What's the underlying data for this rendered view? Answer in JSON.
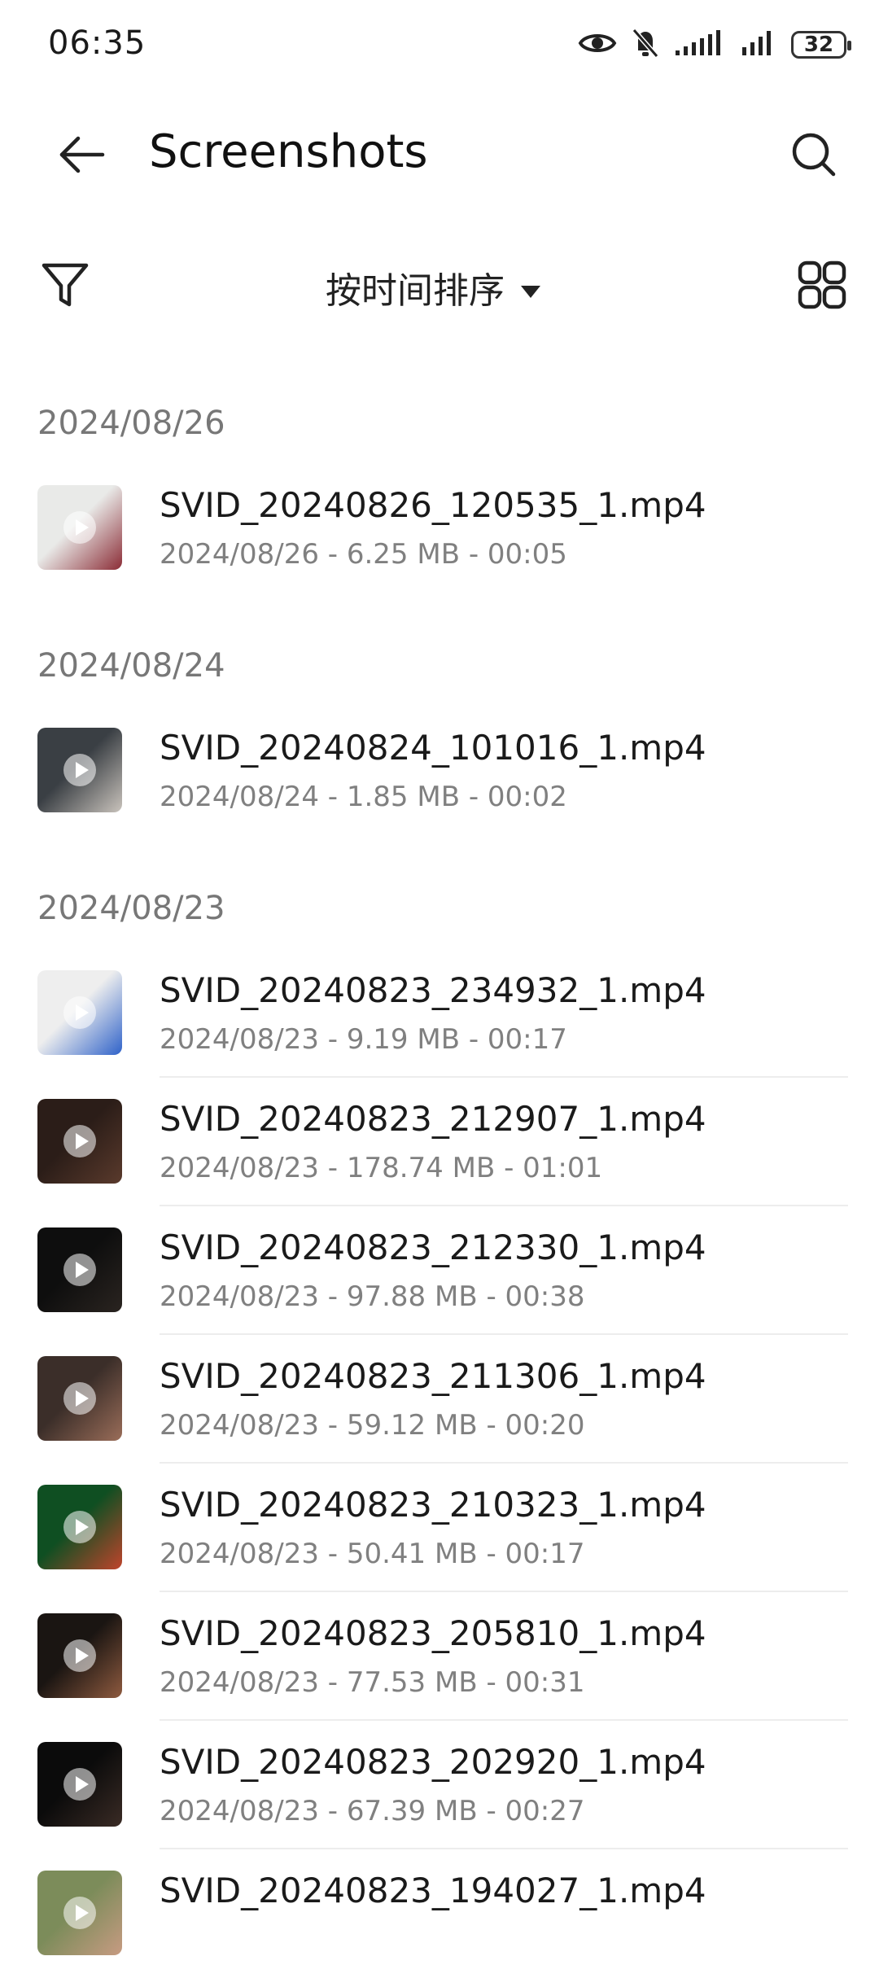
{
  "status_bar": {
    "time": "06:35",
    "battery": "32",
    "icons": [
      "eye-icon",
      "bell-muted-icon",
      "signal-icon",
      "signal-icon",
      "battery-icon"
    ]
  },
  "header": {
    "title": "Screenshots",
    "back_icon": "arrow-left-icon",
    "search_icon": "search-icon"
  },
  "toolbar": {
    "sort_label": "按时间排序",
    "filter_icon": "filter-icon",
    "view_icon": "grid-view-icon"
  },
  "groups": [
    {
      "date": "2024/08/26",
      "items": [
        {
          "name": "SVID_20240826_120535_1.mp4",
          "meta": "2024/08/26 - 6.25 MB - 00:05",
          "thumb_colors": [
            "#e9eae8",
            "#8b2c36"
          ]
        }
      ]
    },
    {
      "date": "2024/08/24",
      "items": [
        {
          "name": "SVID_20240824_101016_1.mp4",
          "meta": "2024/08/24 - 1.85 MB - 00:02",
          "thumb_colors": [
            "#3a3f44",
            "#c9c3bc"
          ]
        }
      ]
    },
    {
      "date": "2024/08/23",
      "items": [
        {
          "name": "SVID_20240823_234932_1.mp4",
          "meta": "2024/08/23 - 9.19 MB - 00:17",
          "thumb_colors": [
            "#eeeeee",
            "#2f62c9"
          ]
        },
        {
          "name": "SVID_20240823_212907_1.mp4",
          "meta": "2024/08/23 - 178.74 MB - 01:01",
          "thumb_colors": [
            "#2b1d18",
            "#5a3a2c"
          ]
        },
        {
          "name": "SVID_20240823_212330_1.mp4",
          "meta": "2024/08/23 - 97.88 MB - 00:38",
          "thumb_colors": [
            "#0e0e0e",
            "#2a2420"
          ]
        },
        {
          "name": "SVID_20240823_211306_1.mp4",
          "meta": "2024/08/23 - 59.12 MB - 00:20",
          "thumb_colors": [
            "#3b2e29",
            "#9a6d59"
          ]
        },
        {
          "name": "SVID_20240823_210323_1.mp4",
          "meta": "2024/08/23 - 50.41 MB - 00:17",
          "thumb_colors": [
            "#0f4f22",
            "#c0442c"
          ]
        },
        {
          "name": "SVID_20240823_205810_1.mp4",
          "meta": "2024/08/23 - 77.53 MB - 00:31",
          "thumb_colors": [
            "#1a1512",
            "#8e5a3f"
          ]
        },
        {
          "name": "SVID_20240823_202920_1.mp4",
          "meta": "2024/08/23 - 67.39 MB - 00:27",
          "thumb_colors": [
            "#0b0b0b",
            "#3a2b25"
          ]
        },
        {
          "name": "SVID_20240823_194027_1.mp4",
          "meta": "",
          "thumb_colors": [
            "#7c8c5a",
            "#c79b82"
          ]
        }
      ]
    }
  ]
}
